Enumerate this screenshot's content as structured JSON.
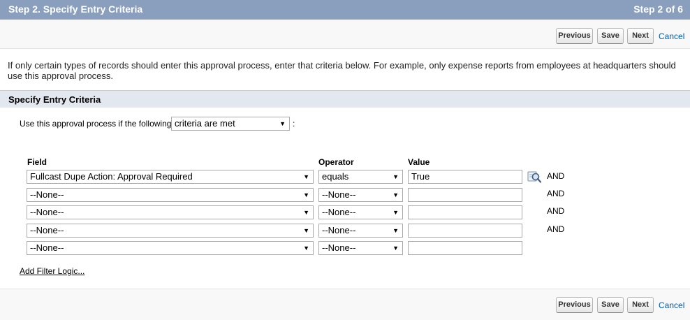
{
  "header": {
    "title": "Step 2. Specify Entry Criteria",
    "step": "Step 2 of 6"
  },
  "buttons": {
    "previous": "Previous",
    "save": "Save",
    "next": "Next",
    "cancel": "Cancel"
  },
  "intro": "If only certain types of records should enter this approval process, enter that criteria below. For example, only expense reports from employees at headquarters should use this approval process.",
  "section": {
    "title": "Specify Entry Criteria"
  },
  "criteria": {
    "label": "Use this approval process if the following",
    "selected": "criteria are met",
    "suffix": ":"
  },
  "columns": {
    "field": "Field",
    "operator": "Operator",
    "value": "Value"
  },
  "rows": [
    {
      "field": "Fullcast Dupe Action: Approval Required",
      "operator": "equals",
      "value": "True",
      "conj": "AND"
    },
    {
      "field": "--None--",
      "operator": "--None--",
      "value": "",
      "conj": "AND"
    },
    {
      "field": "--None--",
      "operator": "--None--",
      "value": "",
      "conj": "AND"
    },
    {
      "field": "--None--",
      "operator": "--None--",
      "value": "",
      "conj": "AND"
    },
    {
      "field": "--None--",
      "operator": "--None--",
      "value": "",
      "conj": ""
    }
  ],
  "icons": {
    "dropdown": "chevron-down-icon",
    "lookup": "lookup-icon"
  },
  "filter_logic_link": "Add Filter Logic...",
  "colors": {
    "header_bg": "#8a9ebe",
    "section_bg": "#e3e7ef",
    "link": "#015ba7"
  }
}
